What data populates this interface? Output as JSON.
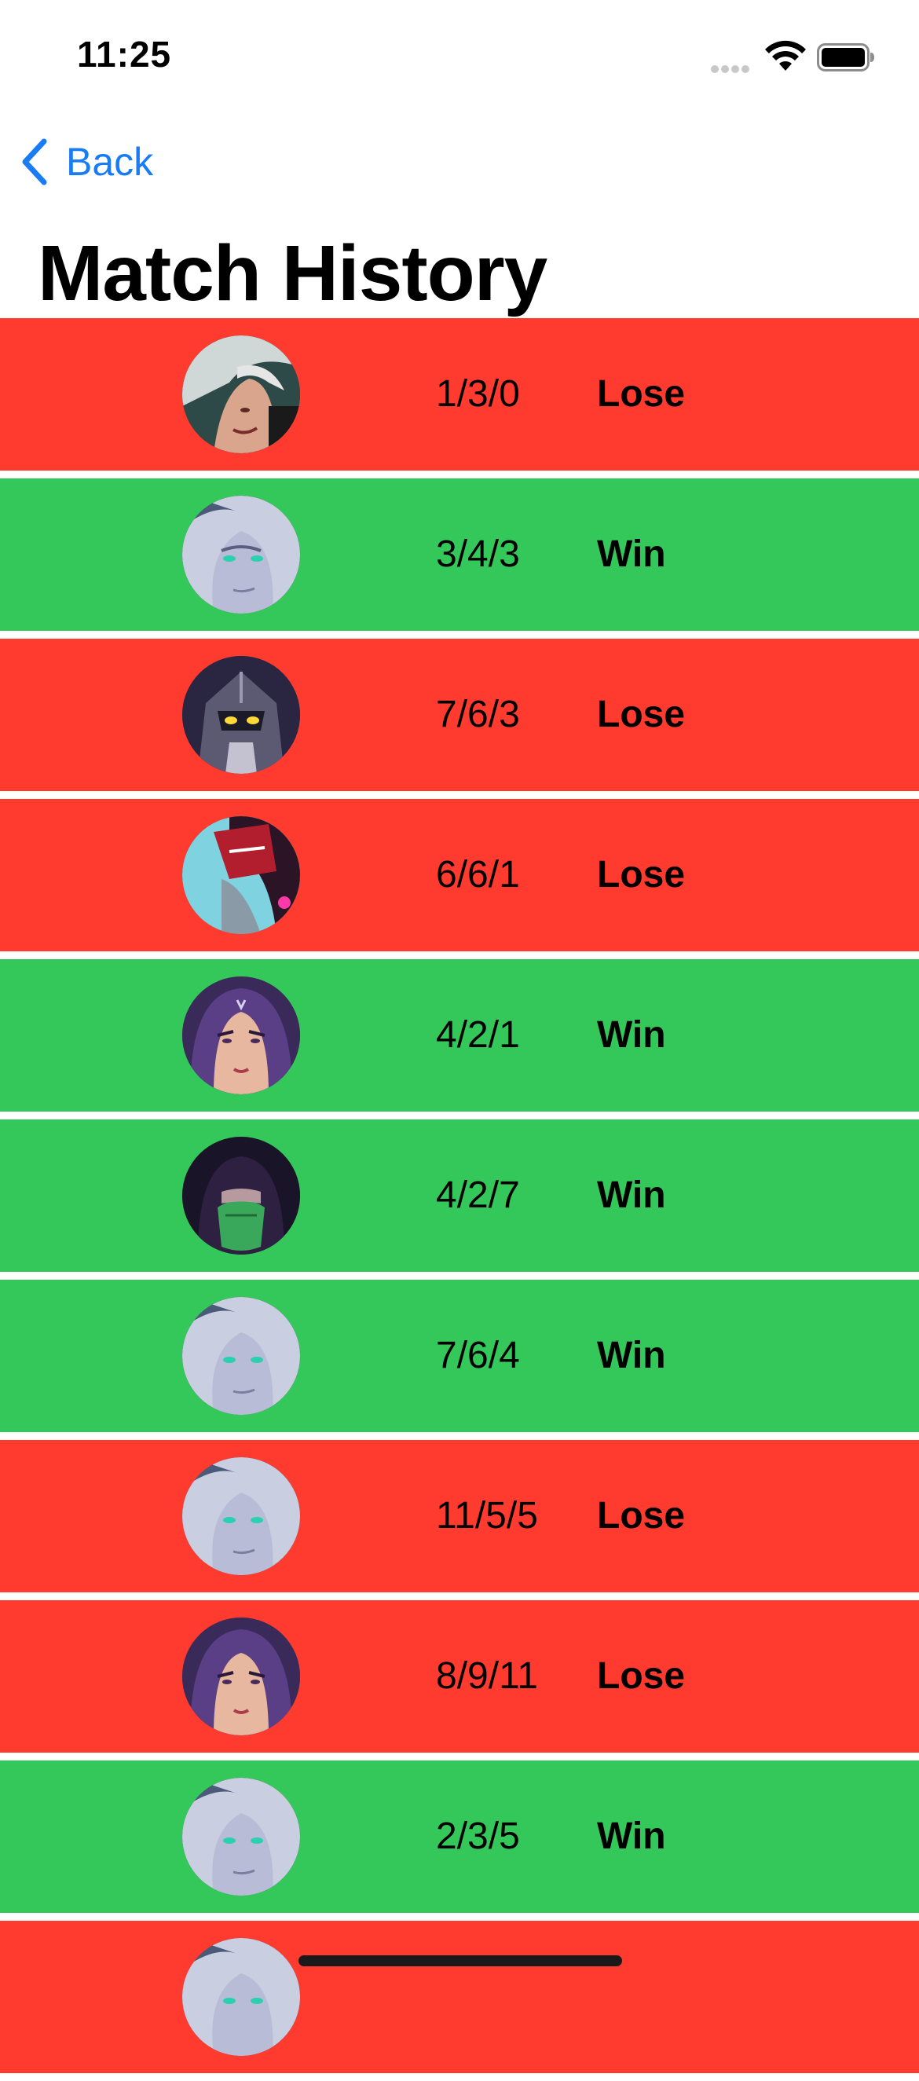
{
  "status_bar": {
    "time": "11:25"
  },
  "nav": {
    "back_label": "Back"
  },
  "page": {
    "title": "Match History"
  },
  "colors": {
    "win": "#34c759",
    "lose": "#ff3b30",
    "accent": "#1a7cf5"
  },
  "matches": [
    {
      "kda": "1/3/0",
      "result": "Lose",
      "champion_icon": "champion-portrait-red-haired-warrior-icon"
    },
    {
      "kda": "3/4/3",
      "result": "Win",
      "champion_icon": "champion-portrait-white-haired-icon"
    },
    {
      "kda": "7/6/3",
      "result": "Lose",
      "champion_icon": "champion-portrait-armored-knight-icon"
    },
    {
      "kda": "6/6/1",
      "result": "Lose",
      "champion_icon": "champion-portrait-red-masked-icon"
    },
    {
      "kda": "4/2/1",
      "result": "Win",
      "champion_icon": "champion-portrait-purple-hooded-woman-icon"
    },
    {
      "kda": "4/2/7",
      "result": "Win",
      "champion_icon": "champion-portrait-green-masked-assassin-icon"
    },
    {
      "kda": "7/6/4",
      "result": "Win",
      "champion_icon": "champion-portrait-white-haired-icon"
    },
    {
      "kda": "11/5/5",
      "result": "Lose",
      "champion_icon": "champion-portrait-white-haired-icon"
    },
    {
      "kda": "8/9/11",
      "result": "Lose",
      "champion_icon": "champion-portrait-purple-hooded-woman-icon"
    },
    {
      "kda": "2/3/5",
      "result": "Win",
      "champion_icon": "champion-portrait-white-haired-icon"
    },
    {
      "kda": "",
      "result": "",
      "champion_icon": "champion-portrait-white-haired-icon"
    }
  ]
}
